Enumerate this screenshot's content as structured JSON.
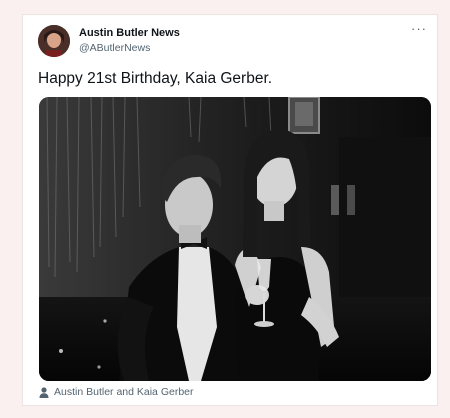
{
  "author": {
    "display_name": "Austin Butler News",
    "handle": "@AButlerNews",
    "avatar_icon": "profile-photo"
  },
  "more_label": "···",
  "tweet": {
    "text": "Happy 21st Birthday, Kaia Gerber."
  },
  "media": {
    "tagged_people": "Austin Butler and Kaia Gerber",
    "tag_icon": "person-icon"
  },
  "colors": {
    "page_background": "#fbf0f0",
    "card_background": "#ffffff",
    "primary_text": "#0f1419",
    "secondary_text": "#536471"
  }
}
